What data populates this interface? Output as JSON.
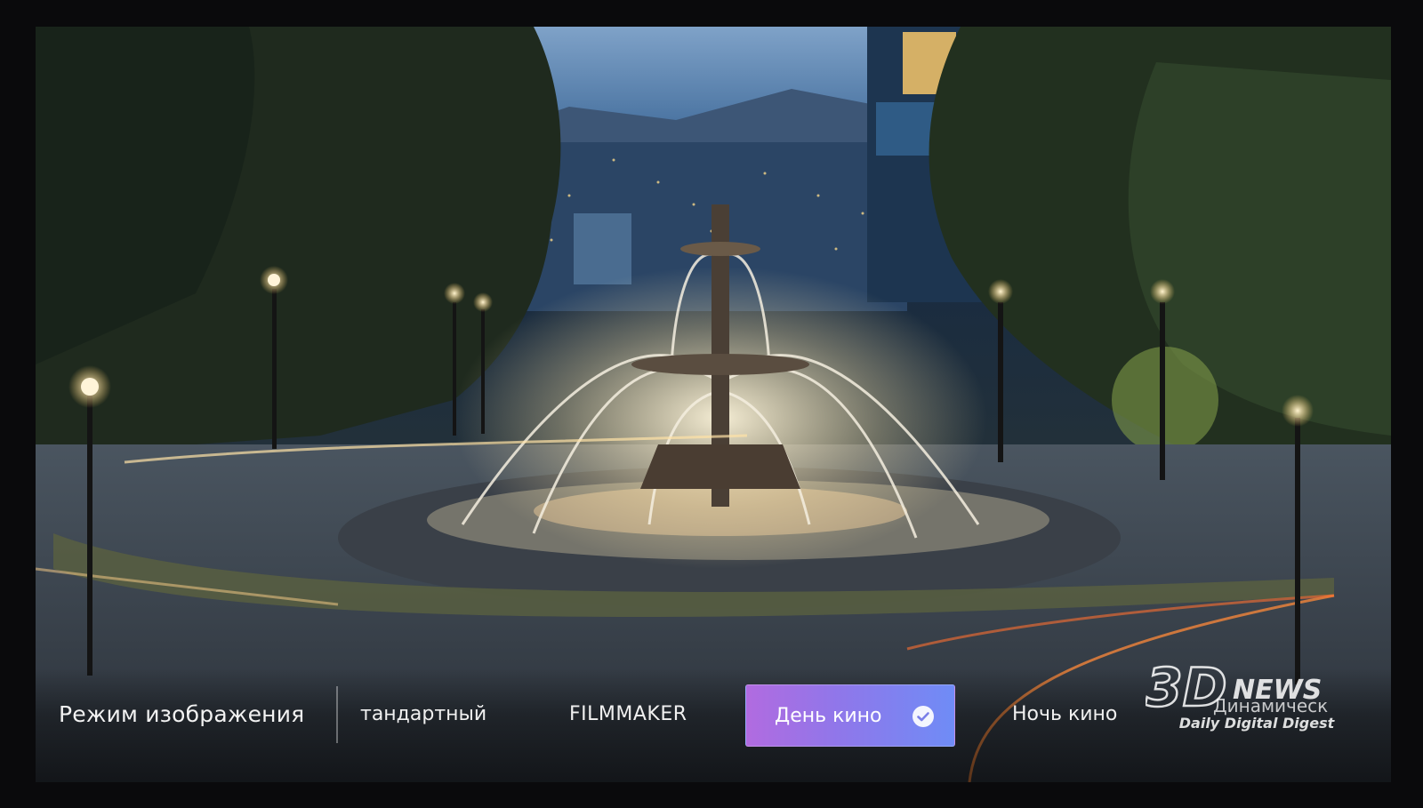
{
  "picture_menu": {
    "title": "Режим изображения",
    "options": [
      {
        "label": "тандартный",
        "selected": false
      },
      {
        "label": "FILMMAKER",
        "selected": false
      },
      {
        "label": "День кино",
        "selected": true
      },
      {
        "label": "Ночь кино",
        "selected": false
      },
      {
        "label": "Динамическ",
        "selected": false
      }
    ]
  },
  "watermark": {
    "logo_text": "3D NEWS",
    "caption": "Daily Digital Digest"
  },
  "colors": {
    "selected_gradient_start": "#b16be0",
    "selected_gradient_end": "#6f8cf6",
    "text": "#f0f0f0"
  },
  "icons": {
    "selected_mark": "check-circle-icon"
  }
}
